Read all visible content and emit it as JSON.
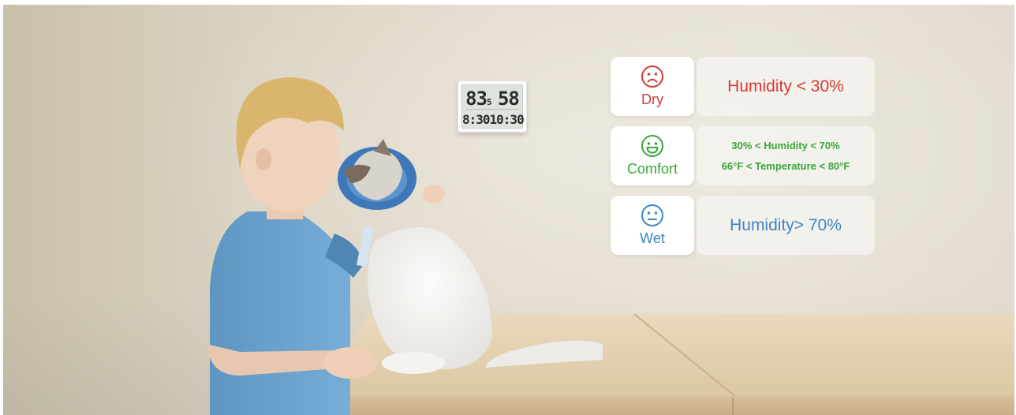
{
  "thermometer": {
    "temperature": "83",
    "temperature_decimal": "5",
    "humidity": "58",
    "time": "8:30",
    "alarm": "10:30"
  },
  "cards": [
    {
      "status": "Dry",
      "icon": "frowning-face-icon",
      "color": "#d43a36",
      "lines": [
        "Humidity < 30%"
      ]
    },
    {
      "status": "Comfort",
      "icon": "smiling-face-icon",
      "color": "#3aa63c",
      "lines": [
        "30% < Humidity < 70%",
        "66°F < Temperature < 80°F"
      ]
    },
    {
      "status": "Wet",
      "icon": "neutral-face-icon",
      "color": "#3c86c7",
      "lines": [
        "Humidity> 70%"
      ]
    }
  ]
}
